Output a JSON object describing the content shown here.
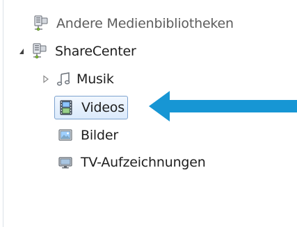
{
  "tree": {
    "items": [
      {
        "label": "Andere Medienbibliotheken",
        "icon": "network-media-icon"
      },
      {
        "label": "ShareCenter",
        "icon": "network-media-icon",
        "expanded": true
      },
      {
        "label": "Musik",
        "icon": "music-note-icon",
        "expanded": false
      },
      {
        "label": "Videos",
        "icon": "video-film-icon",
        "selected": true
      },
      {
        "label": "Bilder",
        "icon": "picture-icon"
      },
      {
        "label": "TV-Aufzeichnungen",
        "icon": "tv-icon"
      }
    ]
  },
  "annotation": {
    "arrow_color": "#1796d4"
  },
  "colors": {
    "selection_border": "#7da2ce",
    "selection_fill_top": "#f1f7ff",
    "selection_fill_bottom": "#dbeafb",
    "text": "#1e1e1e",
    "muted_text": "#5c5c5c"
  }
}
